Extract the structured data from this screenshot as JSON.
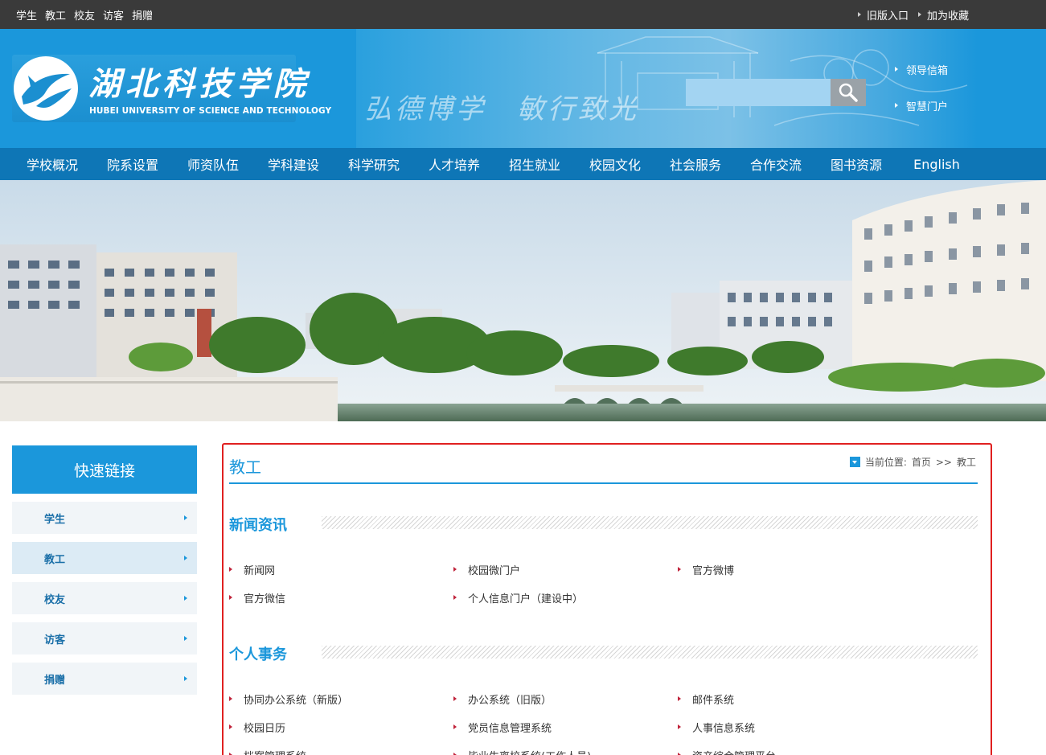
{
  "topbar": {
    "left_links": [
      "学生",
      "教工",
      "校友",
      "访客",
      "捐赠"
    ],
    "right_links": [
      "旧版入口",
      "加为收藏"
    ]
  },
  "header": {
    "logo_cn": "湖北科技学院",
    "logo_en": "HUBEI UNIVERSITY OF SCIENCE AND TECHNOLOGY",
    "motto": "弘德博学　敏行致光",
    "search": {
      "placeholder": "",
      "button_icon": "search-icon"
    },
    "links": [
      "领导信箱",
      "智慧门户"
    ]
  },
  "nav": {
    "items": [
      "学校概况",
      "院系设置",
      "师资队伍",
      "学科建设",
      "科学研究",
      "人才培养",
      "招生就业",
      "校园文化",
      "社会服务",
      "合作交流",
      "图书资源",
      "English"
    ]
  },
  "sidebar": {
    "title": "快速链接",
    "items": [
      {
        "label": "学生",
        "active": false
      },
      {
        "label": "教工",
        "active": true
      },
      {
        "label": "校友",
        "active": false
      },
      {
        "label": "访客",
        "active": false
      },
      {
        "label": "捐赠",
        "active": false
      }
    ]
  },
  "content": {
    "title": "教工",
    "breadcrumb": {
      "prefix": "当前位置:",
      "home": "首页",
      "sep": ">>",
      "current": "教工"
    },
    "sections": [
      {
        "title": "新闻资讯",
        "links": [
          "新闻网",
          "校园微门户",
          "官方微博",
          "官方微信",
          "个人信息门户（建设中）"
        ]
      },
      {
        "title": "个人事务",
        "links": [
          "协同办公系统（新版）",
          "办公系统（旧版）",
          "邮件系统",
          "校园日历",
          "党员信息管理系统",
          "人事信息系统",
          "档案管理系统",
          "毕业生离校系统(工作人员)",
          "资产综合管理平台"
        ]
      }
    ]
  },
  "colors": {
    "accent": "#1b97db",
    "nav": "#0e76b6",
    "topbar": "#3a3a3a",
    "highlight_border": "#e02020"
  }
}
